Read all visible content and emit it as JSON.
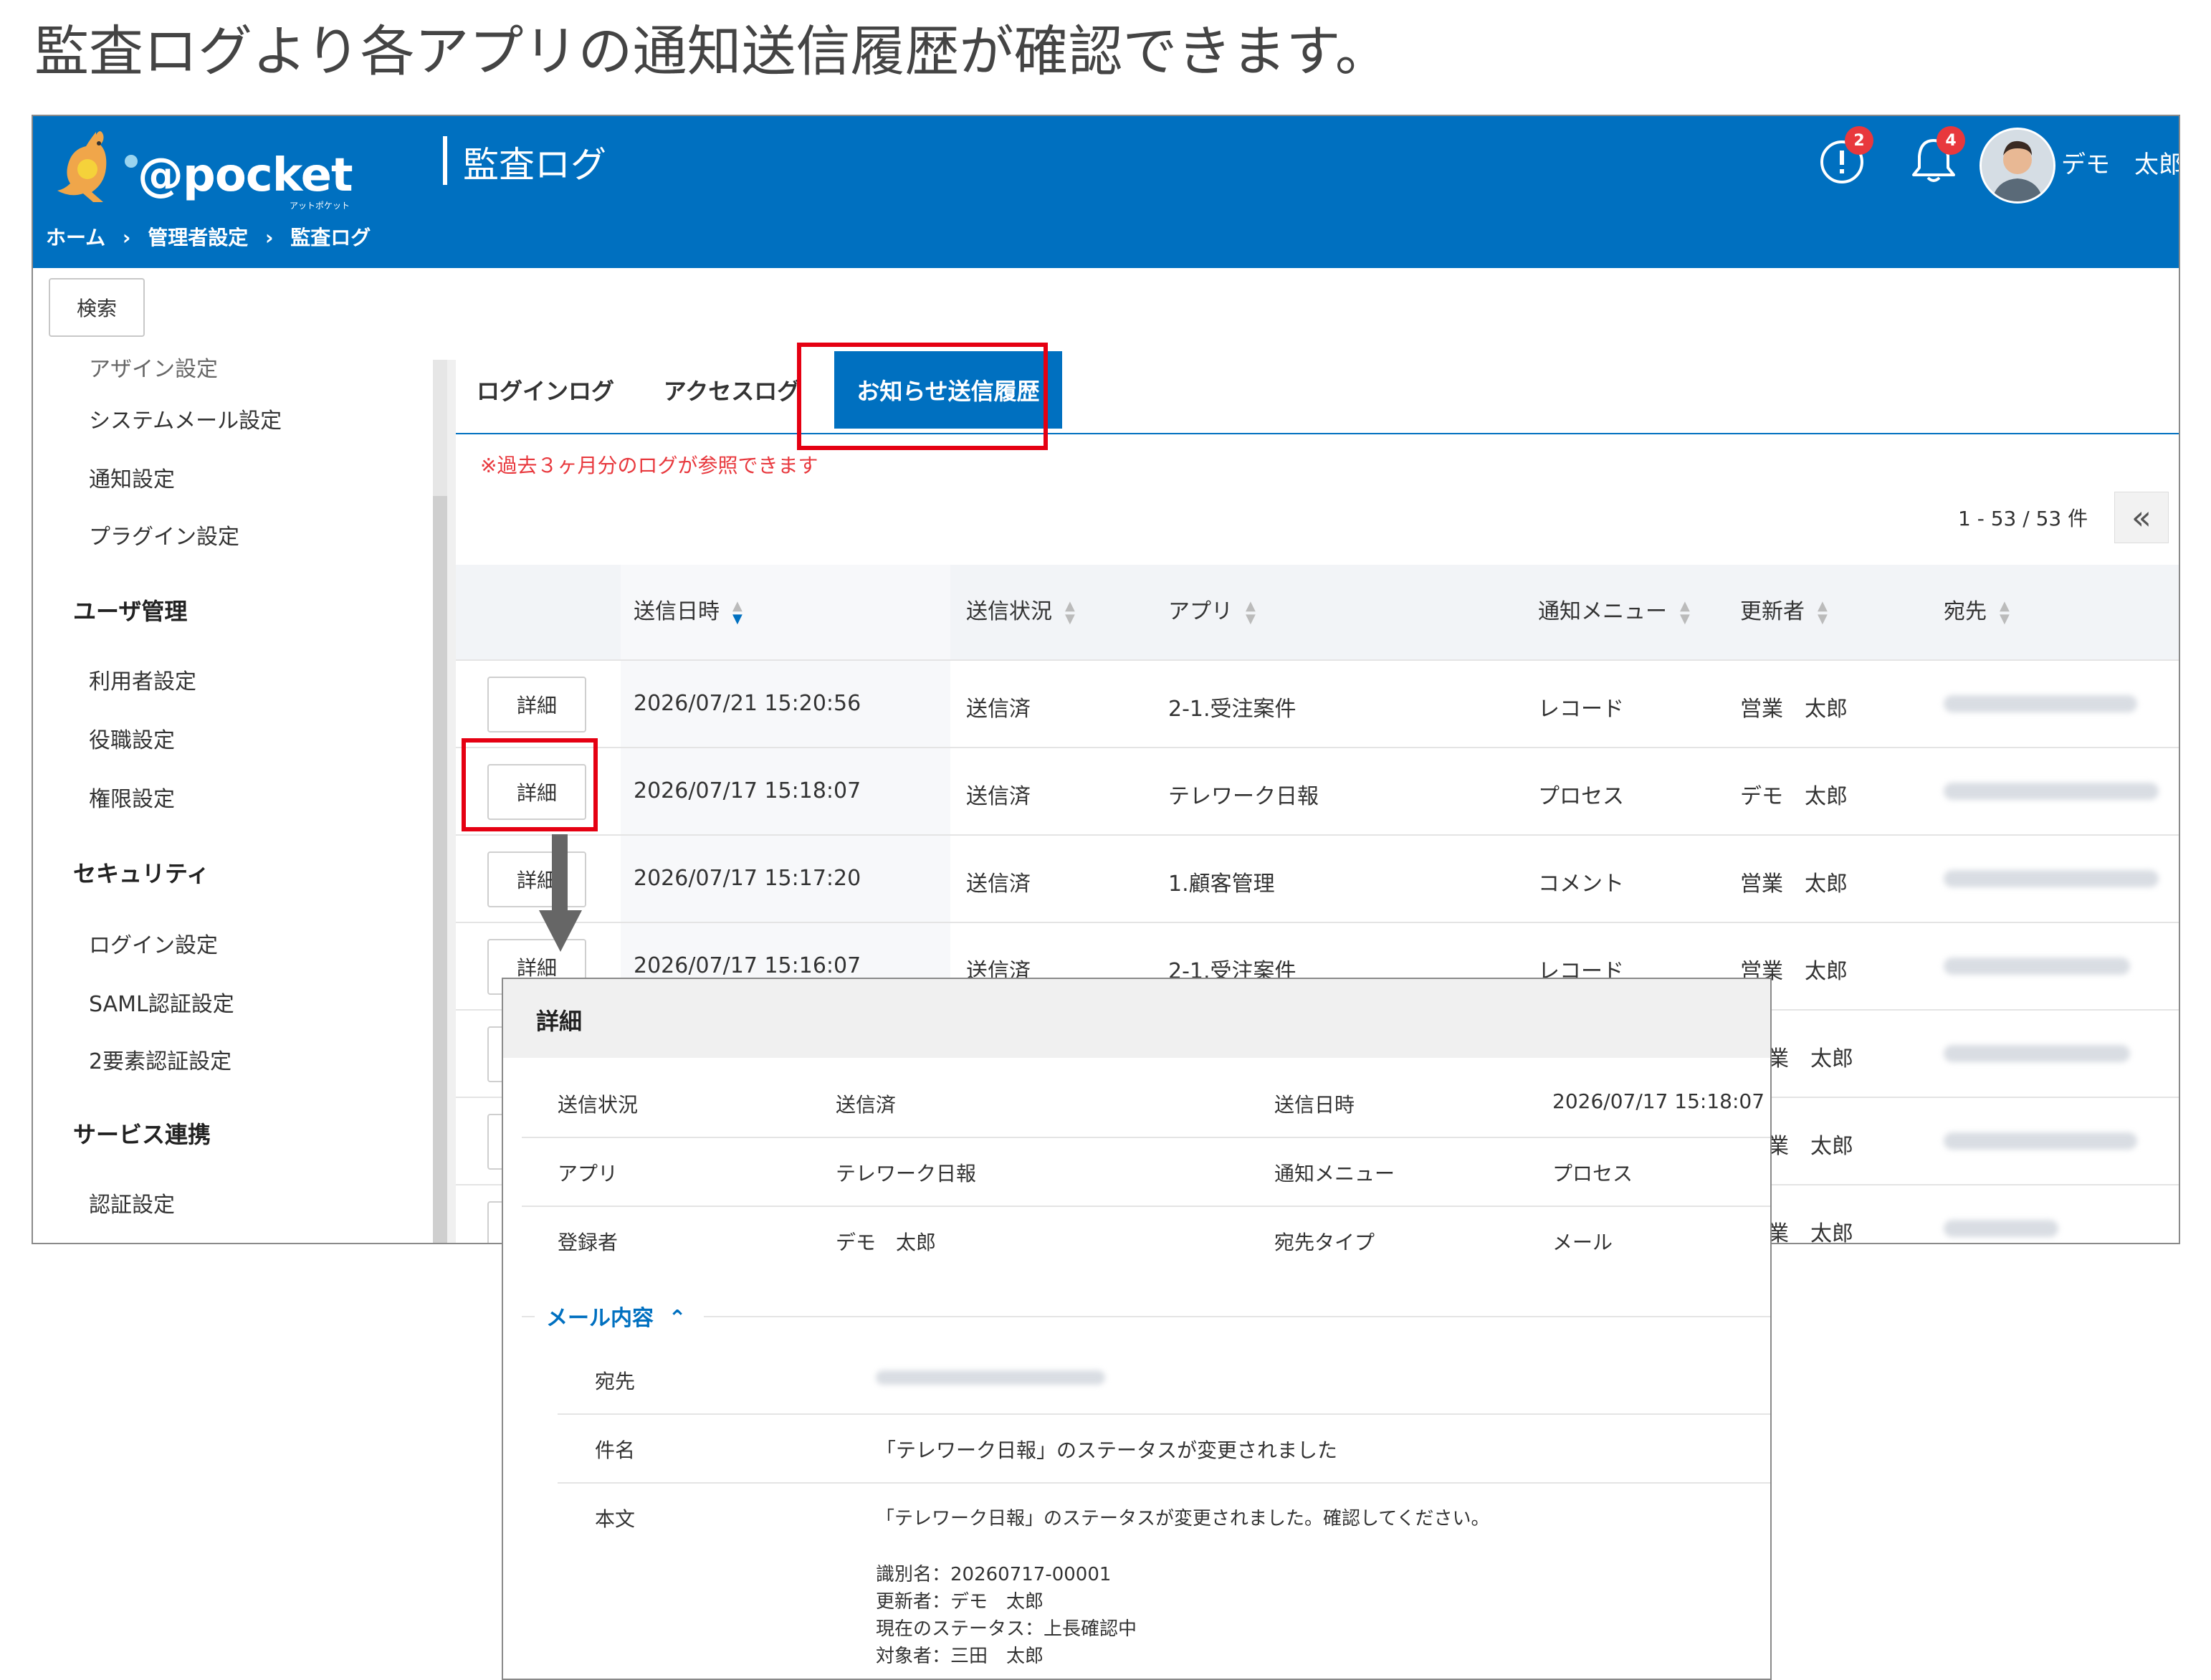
{
  "headline": "監査ログより各アプリの通知送信履歴が確認できます。",
  "header": {
    "logo_text": "@pocket",
    "logo_sub": "アットポケット",
    "page_title": "監査ログ",
    "breadcrumb": [
      "ホーム",
      "管理者設定",
      "監査ログ"
    ],
    "breadcrumb_separator": "›",
    "alert_badge": "2",
    "bell_badge": "4",
    "user_name": "デモ　太郎"
  },
  "search_button": "検索",
  "sidebar": {
    "items": [
      {
        "type": "item",
        "label": "システムメール設定"
      },
      {
        "type": "item",
        "label": "通知設定"
      },
      {
        "type": "item",
        "label": "プラグイン設定"
      },
      {
        "type": "head",
        "label": "ユーザ管理"
      },
      {
        "type": "item",
        "label": "利用者設定"
      },
      {
        "type": "item",
        "label": "役職設定"
      },
      {
        "type": "item",
        "label": "権限設定"
      },
      {
        "type": "head",
        "label": "セキュリティ"
      },
      {
        "type": "item",
        "label": "ログイン設定"
      },
      {
        "type": "item",
        "label": "SAML認証設定"
      },
      {
        "type": "item",
        "label": "2要素認証設定"
      },
      {
        "type": "head",
        "label": "サービス連携"
      },
      {
        "type": "item",
        "label": "認証設定"
      }
    ],
    "cut_item": "アザイン設定"
  },
  "tabs": [
    "ログインログ",
    "アクセスログ",
    "お知らせ送信履歴"
  ],
  "active_tab": 2,
  "notice": "※過去３ヶ月分のログが参照できます",
  "pager": {
    "range": "1 - 53 / 53 件",
    "first_icon": "«"
  },
  "table": {
    "columns": [
      "送信日時",
      "送信状況",
      "アプリ",
      "通知メニュー",
      "更新者",
      "宛先"
    ],
    "detail_label": "詳細",
    "rows": [
      {
        "datetime": "2026/07/21 15:20:56",
        "status": "送信済",
        "app": "2-1.受注案件",
        "menu": "レコード",
        "user": "営業　太郎"
      },
      {
        "datetime": "2026/07/17 15:18:07",
        "status": "送信済",
        "app": "テレワーク日報",
        "menu": "プロセス",
        "user": "デモ　太郎"
      },
      {
        "datetime": "2026/07/17 15:17:20",
        "status": "送信済",
        "app": "1.顧客管理",
        "menu": "コメント",
        "user": "営業　太郎"
      },
      {
        "datetime": "2026/07/17 15:16:07",
        "status": "送信済",
        "app": "2-1.受注案件",
        "menu": "レコード",
        "user": "営業　太郎"
      },
      {
        "user": "業　太郎"
      },
      {
        "user": "業　太郎"
      },
      {
        "user": "業　太郎"
      }
    ]
  },
  "detail": {
    "title": "詳細",
    "fields": {
      "status_label": "送信状況",
      "status_value": "送信済",
      "datetime_label": "送信日時",
      "datetime_value": "2026/07/17 15:18:07",
      "app_label": "アプリ",
      "app_value": "テレワーク日報",
      "menu_label": "通知メニュー",
      "menu_value": "プロセス",
      "registrant_label": "登録者",
      "registrant_value": "デモ　太郎",
      "dest_type_label": "宛先タイプ",
      "dest_type_value": "メール"
    },
    "mail_section": "メール内容",
    "mail": {
      "to_label": "宛先",
      "subject_label": "件名",
      "subject_value": "「テレワーク日報」のステータスが変更されました",
      "body_label": "本文",
      "body_lines": [
        "「テレワーク日報」のステータスが変更されました。確認してください。",
        "",
        "識別名：20260717-00001",
        "更新者：デモ　太郎",
        "現在のステータス：上長確認中",
        "対象者：三田　太郎"
      ]
    }
  },
  "colors": {
    "brand": "#0070c0",
    "highlight": "#e50012",
    "badge": "#e8383d"
  }
}
